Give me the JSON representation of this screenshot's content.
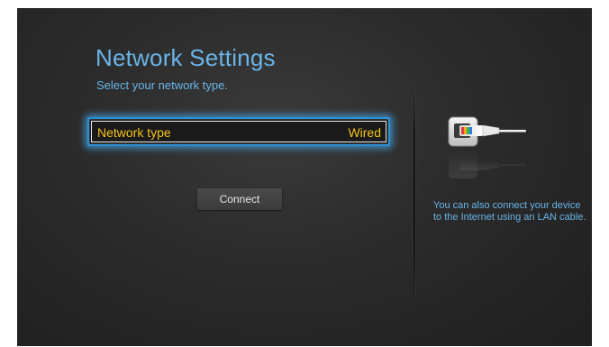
{
  "header": {
    "title": "Network Settings",
    "subtitle": "Select your network type."
  },
  "network_type": {
    "label": "Network type",
    "value": "Wired"
  },
  "actions": {
    "connect_label": "Connect"
  },
  "info_panel": {
    "icon": "lan-cable-icon",
    "text": "You can also connect your device to the Internet using an LAN cable."
  },
  "colors": {
    "title": "#6ab4e8",
    "focus_text": "#f5c21a",
    "focus_glow": "#2b8fd4",
    "background": "#2b2b2b"
  }
}
